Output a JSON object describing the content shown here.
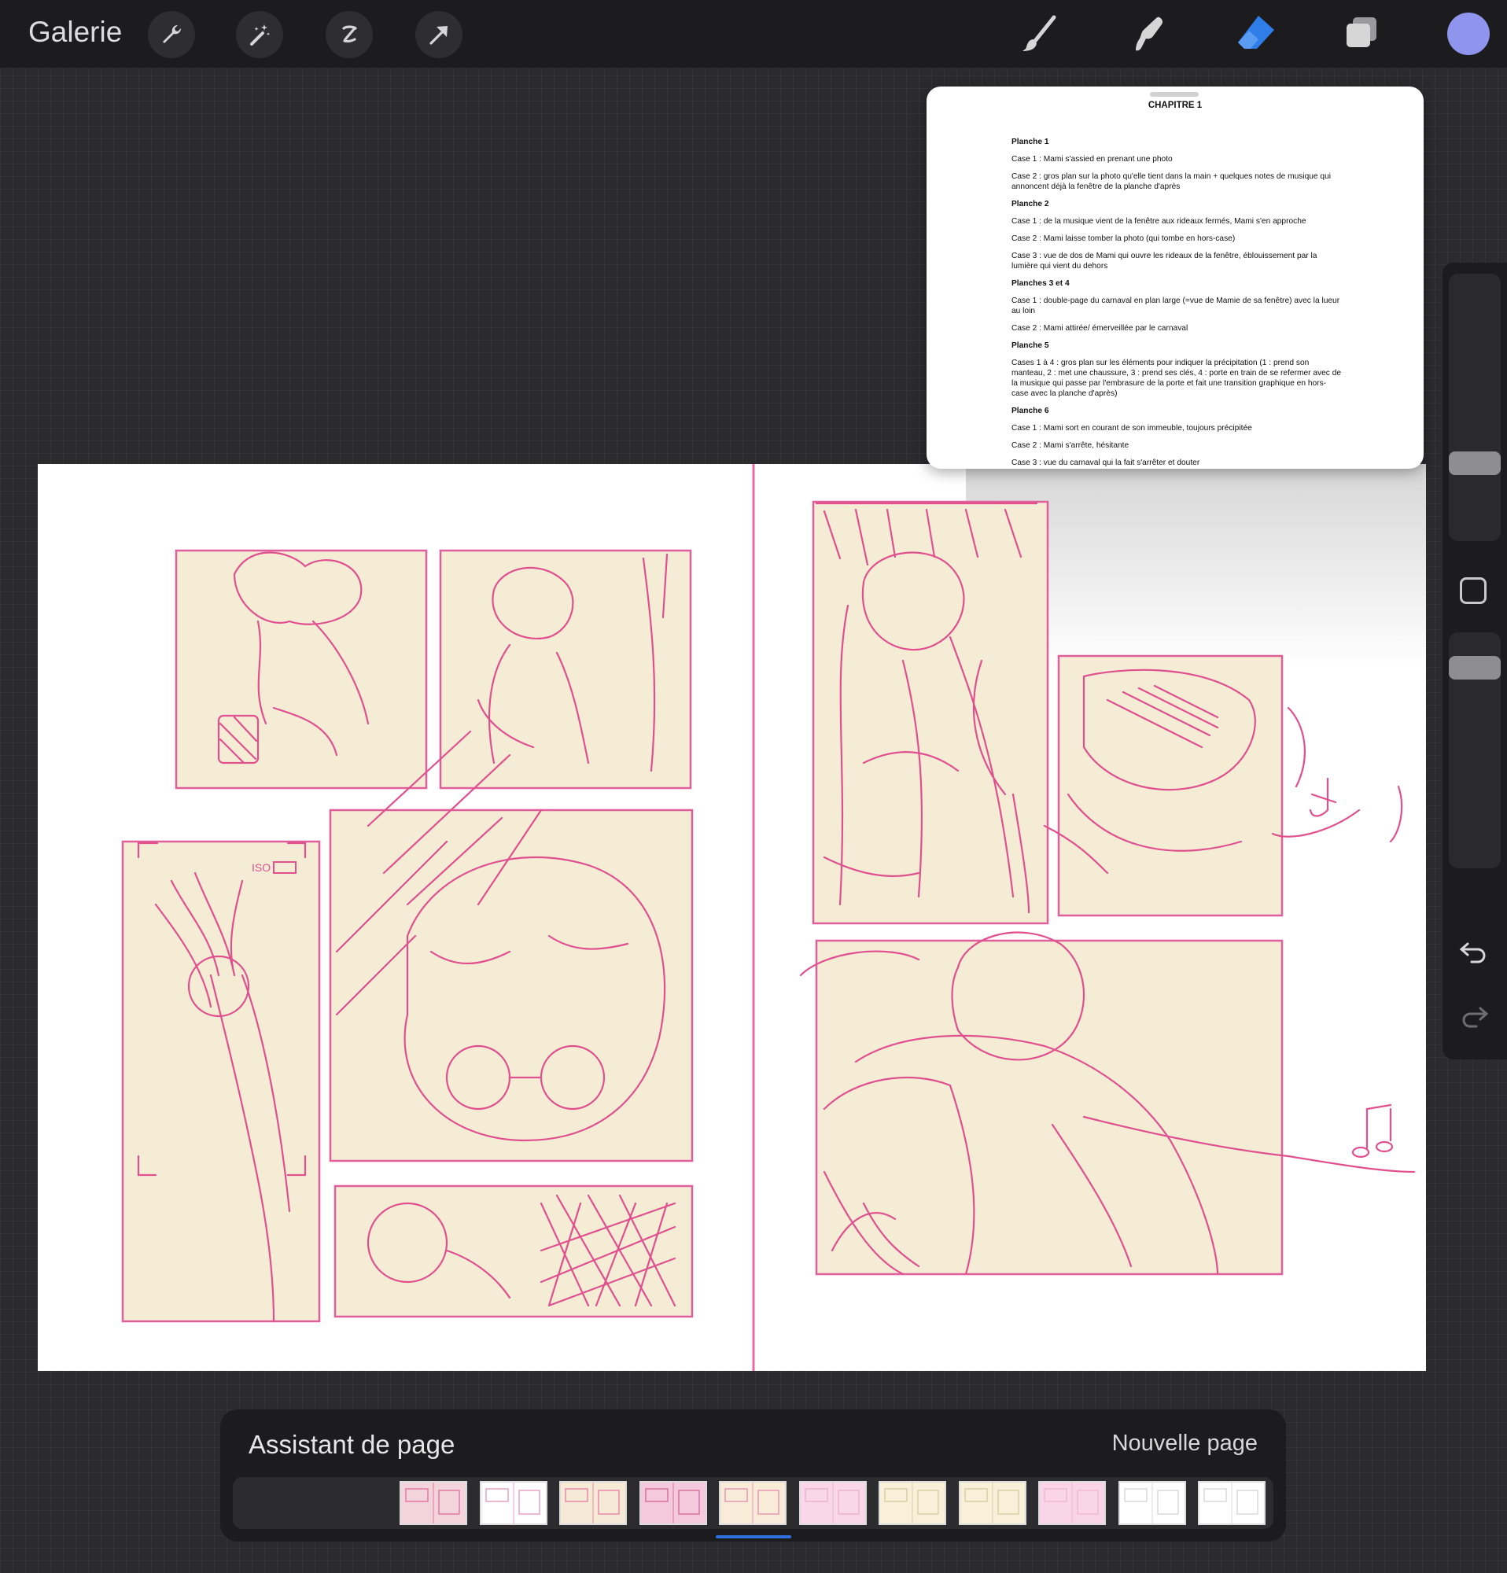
{
  "topbar": {
    "gallery_label": "Galerie",
    "left_tools": [
      "wrench-icon",
      "magic-wand-icon",
      "selection-icon",
      "transform-arrow-icon"
    ],
    "right_tools": [
      "brush-icon",
      "smudge-icon",
      "eraser-icon",
      "layers-icon"
    ],
    "active_tool": "eraser-icon",
    "current_color": "#8f94ec"
  },
  "reference": {
    "title": "CHAPITRE 1",
    "planche1_title": "Planche 1",
    "planche1_case1": "Case 1 : Mami s'assied en prenant une photo",
    "planche1_case2": "Case 2 : gros plan sur la photo qu'elle tient dans la main + quelques notes de musique qui annoncent déjà la fenêtre de la planche d'après",
    "planche2_title": "Planche 2",
    "planche2_case1": "Case 1 : de la musique vient de la fenêtre aux rideaux fermés, Mami s'en approche",
    "planche2_case2": "Case 2 : Mami laisse tomber la photo (qui tombe en hors-case)",
    "planche2_case3": "Case 3 : vue de dos de Mami qui ouvre les rideaux de la fenêtre, éblouissement par la lumière qui vient du dehors",
    "planche34_title": "Planches 3 et 4",
    "planche34_case1": "Case 1 : double-page du carnaval en plan large (=vue de Mamie de sa fenêtre) avec la lueur au loin",
    "planche34_case2": "Case 2 : Mami attirée/ émerveillée par le carnaval",
    "planche5_title": "Planche 5",
    "planche5_cases": "Cases 1 à 4 : gros plan sur les éléments pour indiquer la précipitation (1 : prend son manteau, 2 : met une chaussure, 3 : prend ses clés, 4 : porte en train de se refermer avec de la musique qui passe par l'embrasure de la porte et fait une transition graphique en hors-case avec la planche d'après)",
    "planche6_title": "Planche 6",
    "planche6_case1": "Case 1 : Mami sort en courant de son immeuble, toujours précipitée",
    "planche6_case2": "Case 2 : Mami s'arrête, hésitante",
    "planche6_case3": "Case 3 : vue du carnaval qui la fait s'arrêter et douter"
  },
  "canvas": {
    "hud_text": "ISO"
  },
  "page_assistant": {
    "title": "Assistant de page",
    "new_page_label": "Nouvelle page",
    "pages": [
      {
        "name": "page-1",
        "bg": "#f3d3dc",
        "accent": "#e27aa4"
      },
      {
        "name": "page-2",
        "bg": "#ffffff",
        "accent": "#e9a3c0"
      },
      {
        "name": "page-3",
        "bg": "#f6ead6",
        "accent": "#e58aa9"
      },
      {
        "name": "page-4",
        "bg": "#f5c9dc",
        "accent": "#d872a0"
      },
      {
        "name": "page-5",
        "bg": "#f8ecd9",
        "accent": "#e796b4"
      },
      {
        "name": "page-6",
        "bg": "#f9d7e8",
        "accent": "#eab4cc"
      },
      {
        "name": "page-7",
        "bg": "#f8f0d8",
        "accent": "#d9cfa8"
      },
      {
        "name": "page-8",
        "bg": "#f8f0d8",
        "accent": "#d9cfa8"
      },
      {
        "name": "page-9",
        "bg": "#fad5e8",
        "accent": "#f0b9d3"
      },
      {
        "name": "page-10",
        "bg": "#ffffff",
        "accent": "#d9d9d9"
      },
      {
        "name": "page-11",
        "bg": "#ffffff",
        "accent": "#d9d9d9"
      }
    ],
    "current_page": 5
  }
}
